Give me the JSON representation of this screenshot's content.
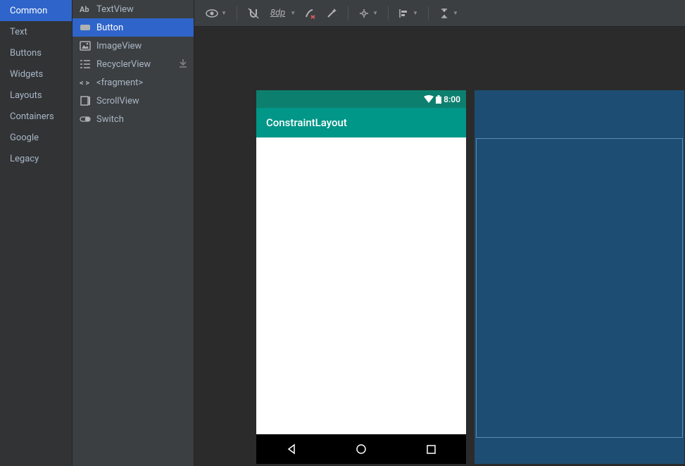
{
  "categories": [
    "Common",
    "Text",
    "Buttons",
    "Widgets",
    "Layouts",
    "Containers",
    "Google",
    "Legacy"
  ],
  "selectedCategory": 0,
  "palette": [
    {
      "label": "TextView",
      "icon": "textview"
    },
    {
      "label": "Button",
      "icon": "button"
    },
    {
      "label": "ImageView",
      "icon": "imageview"
    },
    {
      "label": "RecyclerView",
      "icon": "recyclerview",
      "download": true
    },
    {
      "label": "<fragment>",
      "icon": "fragment"
    },
    {
      "label": "ScrollView",
      "icon": "scrollview"
    },
    {
      "label": "Switch",
      "icon": "switch"
    }
  ],
  "selectedPalette": 1,
  "toolbar": {
    "dp_label": "8dp"
  },
  "device": {
    "status_time": "8:00",
    "app_title": "ConstraintLayout"
  }
}
